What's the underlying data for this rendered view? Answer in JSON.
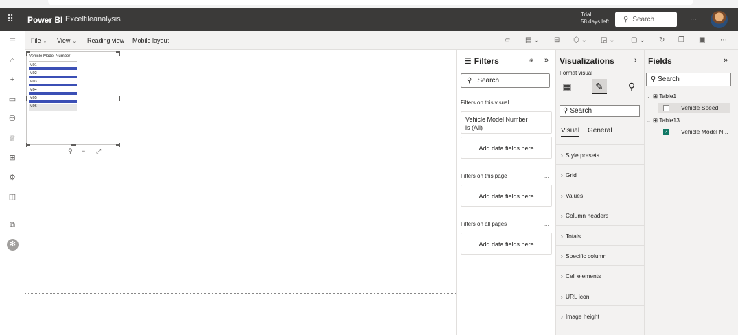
{
  "topbar": {
    "brand": "Power BI",
    "report_name": "Excelfileanalysis",
    "trial_label": "Trial:",
    "trial_days": "58 days left",
    "search_placeholder": "Search",
    "more_label": "..."
  },
  "ribbon": {
    "file": "File",
    "view": "View",
    "reading_view": "Reading view",
    "mobile_layout": "Mobile layout"
  },
  "visual": {
    "title": "Vehicle Model Number",
    "items": [
      "M01",
      "M02",
      "M03",
      "M04",
      "M05",
      "M06"
    ],
    "selected_index": 5
  },
  "filters": {
    "title": "Filters",
    "search_placeholder": "Search",
    "on_visual": "Filters on this visual",
    "filter_field": "Vehicle Model Number",
    "filter_value": "is (All)",
    "add_fields": "Add data fields here",
    "on_page": "Filters on this page",
    "on_all_pages": "Filters on all pages",
    "more": "..."
  },
  "visualizations": {
    "title": "Visualizations",
    "format_visual": "Format visual",
    "search_placeholder": "Search",
    "tab_visual": "Visual",
    "tab_general": "General",
    "more": "...",
    "sections": [
      "Style presets",
      "Grid",
      "Values",
      "Column headers",
      "Totals",
      "Specific column",
      "Cell elements",
      "URL icon",
      "Image height"
    ]
  },
  "fields": {
    "title": "Fields",
    "search_placeholder": "Search",
    "tables": [
      {
        "name": "Table1",
        "fields": [
          {
            "name": "Vehicle Speed",
            "checked": false
          }
        ]
      },
      {
        "name": "Table13",
        "fields": [
          {
            "name": "Vehicle Model N...",
            "checked": true
          }
        ]
      }
    ]
  },
  "colors": {
    "topbar": "#3b3a39",
    "slicer_bar": "#3b4fb5",
    "check": "#117865"
  }
}
